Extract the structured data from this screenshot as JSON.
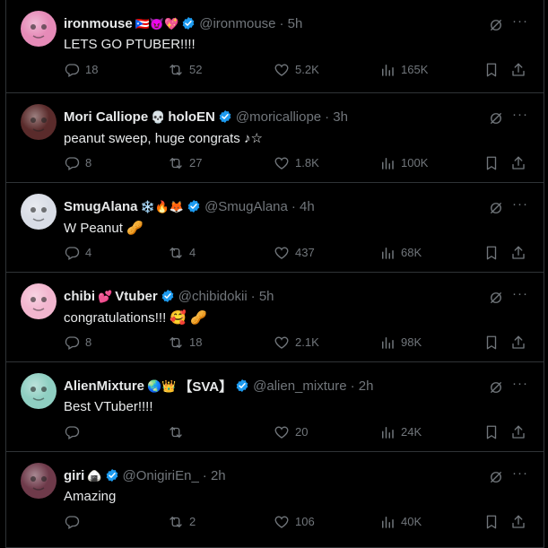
{
  "tweets": [
    {
      "name": "ironmouse",
      "name_emoji": "🇵🇷😈💖",
      "handle": "@ironmouse",
      "time": "· 5h",
      "text": "LETS GO PTUBER!!!!",
      "replies": "18",
      "reposts": "52",
      "likes": "5.2K",
      "views": "165K",
      "avatar_color": "#e68bb8"
    },
    {
      "name": "Mori Calliope",
      "name_emoji": "💀",
      "name_suffix": "holoEN",
      "handle": "@moricalliope",
      "time": "· 3h",
      "text": "peanut sweep, huge congrats ♪☆",
      "replies": "8",
      "reposts": "27",
      "likes": "1.8K",
      "views": "100K",
      "avatar_color": "#5a2b2b"
    },
    {
      "name": "SmugAlana",
      "name_emoji": "❄️🔥🦊",
      "handle": "@SmugAlana",
      "time": "· 4h",
      "text": "W Peanut 🥜",
      "replies": "4",
      "reposts": "4",
      "likes": "437",
      "views": "68K",
      "avatar_color": "#d9dde6"
    },
    {
      "name": "chibi",
      "name_emoji": "💕",
      "name_suffix": "Vtuber",
      "handle": "@chibidokii",
      "time": "· 5h",
      "text": "congratulations!!! 🥰 🥜",
      "replies": "8",
      "reposts": "18",
      "likes": "2.1K",
      "views": "98K",
      "avatar_color": "#f2b6cf"
    },
    {
      "name": "AlienMixture",
      "name_emoji": "🌏👑",
      "name_suffix": "【SVA】",
      "handle": "@alien_mixture",
      "time": "· 2h",
      "text": "Best VTuber!!!!",
      "replies": "",
      "reposts": "",
      "likes": "20",
      "views": "24K",
      "avatar_color": "#8fcfc2"
    },
    {
      "name": "giri",
      "name_emoji": "🍙",
      "handle": "@OnigiriEn_",
      "time": "· 2h",
      "text": "Amazing",
      "replies": "",
      "reposts": "2",
      "likes": "106",
      "views": "40K",
      "avatar_color": "#6e3a4a"
    }
  ],
  "colors": {
    "background": "#000000",
    "text": "#e7e9ea",
    "muted": "#71767b",
    "verified": "#1d9bf0",
    "divider": "#2f3336"
  }
}
